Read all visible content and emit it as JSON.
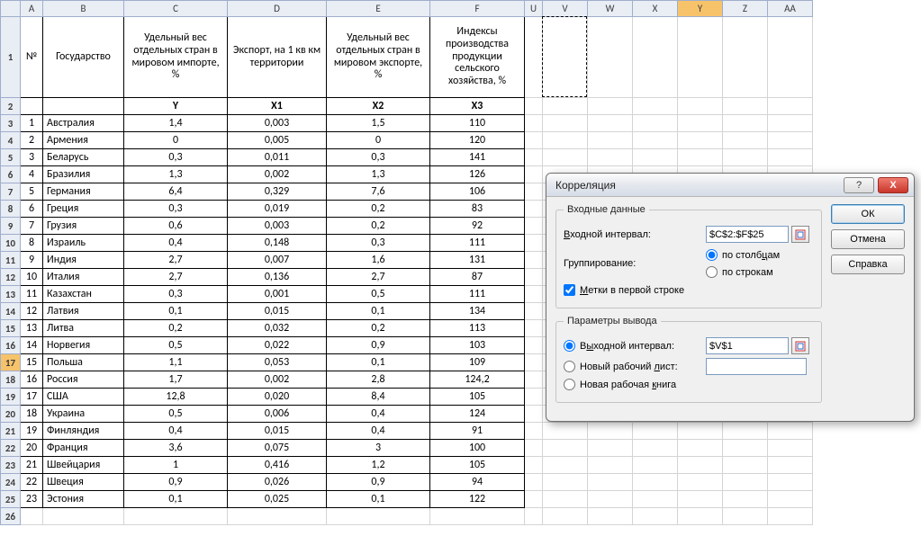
{
  "columns": [
    "A",
    "B",
    "C",
    "D",
    "E",
    "F",
    "U",
    "V",
    "W",
    "X",
    "Y",
    "Z",
    "AA"
  ],
  "active_col": "Y",
  "headers": {
    "A": "№",
    "B": "Государство",
    "C": "Удельный вес отдельных стран в мировом импорте, %",
    "D": "Экспорт, на 1 кв км территории",
    "E": "Удельный вес отдельных стран в мировом экспорте, %",
    "F": "Индексы производства продукции сельского хозяйства, %"
  },
  "vars": {
    "C": "Y",
    "D": "X1",
    "E": "X2",
    "F": "X3"
  },
  "rows": [
    {
      "n": 1,
      "state": "Австралия",
      "c": "1,4",
      "d": "0,003",
      "e": "1,5",
      "f": "110"
    },
    {
      "n": 2,
      "state": "Армения",
      "c": "0",
      "d": "0,005",
      "e": "0",
      "f": "120"
    },
    {
      "n": 3,
      "state": "Беларусь",
      "c": "0,3",
      "d": "0,011",
      "e": "0,3",
      "f": "141"
    },
    {
      "n": 4,
      "state": "Бразилия",
      "c": "1,3",
      "d": "0,002",
      "e": "1,3",
      "f": "126"
    },
    {
      "n": 5,
      "state": "Германия",
      "c": "6,4",
      "d": "0,329",
      "e": "7,6",
      "f": "106"
    },
    {
      "n": 6,
      "state": "Греция",
      "c": "0,3",
      "d": "0,019",
      "e": "0,2",
      "f": "83"
    },
    {
      "n": 7,
      "state": "Грузия",
      "c": "0,6",
      "d": "0,003",
      "e": "0,2",
      "f": "92"
    },
    {
      "n": 8,
      "state": "Израиль",
      "c": "0,4",
      "d": "0,148",
      "e": "0,3",
      "f": "111"
    },
    {
      "n": 9,
      "state": "Индия",
      "c": "2,7",
      "d": "0,007",
      "e": "1,6",
      "f": "131"
    },
    {
      "n": 10,
      "state": "Италия",
      "c": "2,7",
      "d": "0,136",
      "e": "2,7",
      "f": "87"
    },
    {
      "n": 11,
      "state": "Казахстан",
      "c": "0,3",
      "d": "0,001",
      "e": "0,5",
      "f": "111"
    },
    {
      "n": 12,
      "state": "Латвия",
      "c": "0,1",
      "d": "0,015",
      "e": "0,1",
      "f": "134"
    },
    {
      "n": 13,
      "state": "Литва",
      "c": "0,2",
      "d": "0,032",
      "e": "0,2",
      "f": "113"
    },
    {
      "n": 14,
      "state": "Норвегия",
      "c": "0,5",
      "d": "0,022",
      "e": "0,9",
      "f": "103"
    },
    {
      "n": 15,
      "state": "Польша",
      "c": "1,1",
      "d": "0,053",
      "e": "0,1",
      "f": "109"
    },
    {
      "n": 16,
      "state": "Россия",
      "c": "1,7",
      "d": "0,002",
      "e": "2,8",
      "f": "124,2"
    },
    {
      "n": 17,
      "state": "США",
      "c": "12,8",
      "d": "0,020",
      "e": "8,4",
      "f": "105"
    },
    {
      "n": 18,
      "state": "Украина",
      "c": "0,5",
      "d": "0,006",
      "e": "0,4",
      "f": "124"
    },
    {
      "n": 19,
      "state": "Финляндия",
      "c": "0,4",
      "d": "0,015",
      "e": "0,4",
      "f": "91"
    },
    {
      "n": 20,
      "state": "Франция",
      "c": "3,6",
      "d": "0,075",
      "e": "3",
      "f": "100"
    },
    {
      "n": 21,
      "state": "Швейцария",
      "c": "1",
      "d": "0,416",
      "e": "1,2",
      "f": "105"
    },
    {
      "n": 22,
      "state": "Швеция",
      "c": "0,9",
      "d": "0,026",
      "e": "0,9",
      "f": "94"
    },
    {
      "n": 23,
      "state": "Эстония",
      "c": "0,1",
      "d": "0,025",
      "e": "0,1",
      "f": "122"
    }
  ],
  "active_rows": [
    17
  ],
  "dialog": {
    "title": "Корреляция",
    "grp_input": "Входные данные",
    "input_range_label": "Входной интервал:",
    "input_range_value": "$C$2:$F$25",
    "grouping_label": "Группирование:",
    "by_cols": "по столбцам",
    "by_rows": "по строкам",
    "labels_first_row": "Метки в первой строке",
    "grp_output": "Параметры вывода",
    "output_range": "Выходной интервал:",
    "output_range_value": "$V$1",
    "new_sheet": "Новый рабочий лист:",
    "new_book": "Новая рабочая книга",
    "ok": "ОК",
    "cancel": "Отмена",
    "help": "Справка",
    "help_btn": "?",
    "close_btn": "X"
  },
  "chart_data": {
    "type": "table",
    "columns": [
      "№",
      "Государство",
      "Y",
      "X1",
      "X2",
      "X3"
    ],
    "column_labels": {
      "Y": "Удельный вес отдельных стран в мировом импорте, %",
      "X1": "Экспорт, на 1 кв км территории",
      "X2": "Удельный вес отдельных стран в мировом экспорте, %",
      "X3": "Индексы производства продукции сельского хозяйства, %"
    },
    "data": [
      [
        1,
        "Австралия",
        1.4,
        0.003,
        1.5,
        110
      ],
      [
        2,
        "Армения",
        0,
        0.005,
        0,
        120
      ],
      [
        3,
        "Беларусь",
        0.3,
        0.011,
        0.3,
        141
      ],
      [
        4,
        "Бразилия",
        1.3,
        0.002,
        1.3,
        126
      ],
      [
        5,
        "Германия",
        6.4,
        0.329,
        7.6,
        106
      ],
      [
        6,
        "Греция",
        0.3,
        0.019,
        0.2,
        83
      ],
      [
        7,
        "Грузия",
        0.6,
        0.003,
        0.2,
        92
      ],
      [
        8,
        "Израиль",
        0.4,
        0.148,
        0.3,
        111
      ],
      [
        9,
        "Индия",
        2.7,
        0.007,
        1.6,
        131
      ],
      [
        10,
        "Италия",
        2.7,
        0.136,
        2.7,
        87
      ],
      [
        11,
        "Казахстан",
        0.3,
        0.001,
        0.5,
        111
      ],
      [
        12,
        "Латвия",
        0.1,
        0.015,
        0.1,
        134
      ],
      [
        13,
        "Литва",
        0.2,
        0.032,
        0.2,
        113
      ],
      [
        14,
        "Норвегия",
        0.5,
        0.022,
        0.9,
        103
      ],
      [
        15,
        "Польша",
        1.1,
        0.053,
        0.1,
        109
      ],
      [
        16,
        "Россия",
        1.7,
        0.002,
        2.8,
        124.2
      ],
      [
        17,
        "США",
        12.8,
        0.02,
        8.4,
        105
      ],
      [
        18,
        "Украина",
        0.5,
        0.006,
        0.4,
        124
      ],
      [
        19,
        "Финляндия",
        0.4,
        0.015,
        0.4,
        91
      ],
      [
        20,
        "Франция",
        3.6,
        0.075,
        3,
        100
      ],
      [
        21,
        "Швейцария",
        1,
        0.416,
        1.2,
        105
      ],
      [
        22,
        "Швеция",
        0.9,
        0.026,
        0.9,
        94
      ],
      [
        23,
        "Эстония",
        0.1,
        0.025,
        0.1,
        122
      ]
    ]
  }
}
